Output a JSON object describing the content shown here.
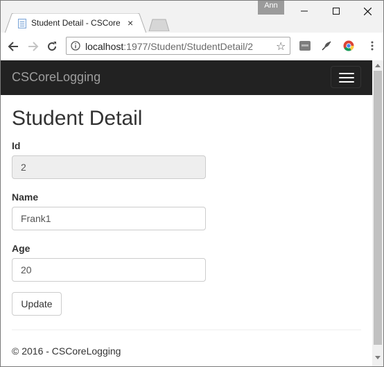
{
  "browser": {
    "tab_title": "Student Detail - CSCoreL",
    "tab_close": "×",
    "profile_name": "Ann",
    "url_host": "localhost",
    "url_path": ":1977/Student/StudentDetail/2",
    "star": "☆"
  },
  "app": {
    "brand": "CSCoreLogging"
  },
  "page": {
    "title": "Student Detail",
    "fields": {
      "id_label": "Id",
      "id_value": "2",
      "name_label": "Name",
      "name_value": "Frank1",
      "age_label": "Age",
      "age_value": "20"
    },
    "update_label": "Update",
    "footer": "© 2016 - CSCoreLogging"
  },
  "colors": {
    "navbar": "#222222",
    "brand_text": "#9d9d9d",
    "readonly_bg": "#eeeeee"
  }
}
